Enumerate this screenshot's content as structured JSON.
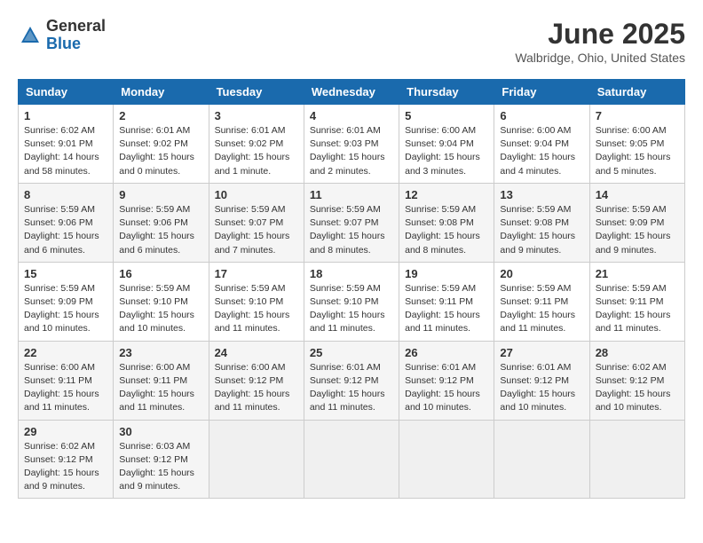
{
  "header": {
    "logo": {
      "general": "General",
      "blue": "Blue"
    },
    "title": "June 2025",
    "location": "Walbridge, Ohio, United States"
  },
  "weekdays": [
    "Sunday",
    "Monday",
    "Tuesday",
    "Wednesday",
    "Thursday",
    "Friday",
    "Saturday"
  ],
  "weeks": [
    [
      {
        "day": 1,
        "sunrise": "6:02 AM",
        "sunset": "9:01 PM",
        "daylight": "14 hours and 58 minutes."
      },
      {
        "day": 2,
        "sunrise": "6:01 AM",
        "sunset": "9:02 PM",
        "daylight": "15 hours and 0 minutes."
      },
      {
        "day": 3,
        "sunrise": "6:01 AM",
        "sunset": "9:02 PM",
        "daylight": "15 hours and 1 minute."
      },
      {
        "day": 4,
        "sunrise": "6:01 AM",
        "sunset": "9:03 PM",
        "daylight": "15 hours and 2 minutes."
      },
      {
        "day": 5,
        "sunrise": "6:00 AM",
        "sunset": "9:04 PM",
        "daylight": "15 hours and 3 minutes."
      },
      {
        "day": 6,
        "sunrise": "6:00 AM",
        "sunset": "9:04 PM",
        "daylight": "15 hours and 4 minutes."
      },
      {
        "day": 7,
        "sunrise": "6:00 AM",
        "sunset": "9:05 PM",
        "daylight": "15 hours and 5 minutes."
      }
    ],
    [
      {
        "day": 8,
        "sunrise": "5:59 AM",
        "sunset": "9:06 PM",
        "daylight": "15 hours and 6 minutes."
      },
      {
        "day": 9,
        "sunrise": "5:59 AM",
        "sunset": "9:06 PM",
        "daylight": "15 hours and 6 minutes."
      },
      {
        "day": 10,
        "sunrise": "5:59 AM",
        "sunset": "9:07 PM",
        "daylight": "15 hours and 7 minutes."
      },
      {
        "day": 11,
        "sunrise": "5:59 AM",
        "sunset": "9:07 PM",
        "daylight": "15 hours and 8 minutes."
      },
      {
        "day": 12,
        "sunrise": "5:59 AM",
        "sunset": "9:08 PM",
        "daylight": "15 hours and 8 minutes."
      },
      {
        "day": 13,
        "sunrise": "5:59 AM",
        "sunset": "9:08 PM",
        "daylight": "15 hours and 9 minutes."
      },
      {
        "day": 14,
        "sunrise": "5:59 AM",
        "sunset": "9:09 PM",
        "daylight": "15 hours and 9 minutes."
      }
    ],
    [
      {
        "day": 15,
        "sunrise": "5:59 AM",
        "sunset": "9:09 PM",
        "daylight": "15 hours and 10 minutes."
      },
      {
        "day": 16,
        "sunrise": "5:59 AM",
        "sunset": "9:10 PM",
        "daylight": "15 hours and 10 minutes."
      },
      {
        "day": 17,
        "sunrise": "5:59 AM",
        "sunset": "9:10 PM",
        "daylight": "15 hours and 11 minutes."
      },
      {
        "day": 18,
        "sunrise": "5:59 AM",
        "sunset": "9:10 PM",
        "daylight": "15 hours and 11 minutes."
      },
      {
        "day": 19,
        "sunrise": "5:59 AM",
        "sunset": "9:11 PM",
        "daylight": "15 hours and 11 minutes."
      },
      {
        "day": 20,
        "sunrise": "5:59 AM",
        "sunset": "9:11 PM",
        "daylight": "15 hours and 11 minutes."
      },
      {
        "day": 21,
        "sunrise": "5:59 AM",
        "sunset": "9:11 PM",
        "daylight": "15 hours and 11 minutes."
      }
    ],
    [
      {
        "day": 22,
        "sunrise": "6:00 AM",
        "sunset": "9:11 PM",
        "daylight": "15 hours and 11 minutes."
      },
      {
        "day": 23,
        "sunrise": "6:00 AM",
        "sunset": "9:11 PM",
        "daylight": "15 hours and 11 minutes."
      },
      {
        "day": 24,
        "sunrise": "6:00 AM",
        "sunset": "9:12 PM",
        "daylight": "15 hours and 11 minutes."
      },
      {
        "day": 25,
        "sunrise": "6:01 AM",
        "sunset": "9:12 PM",
        "daylight": "15 hours and 11 minutes."
      },
      {
        "day": 26,
        "sunrise": "6:01 AM",
        "sunset": "9:12 PM",
        "daylight": "15 hours and 10 minutes."
      },
      {
        "day": 27,
        "sunrise": "6:01 AM",
        "sunset": "9:12 PM",
        "daylight": "15 hours and 10 minutes."
      },
      {
        "day": 28,
        "sunrise": "6:02 AM",
        "sunset": "9:12 PM",
        "daylight": "15 hours and 10 minutes."
      }
    ],
    [
      {
        "day": 29,
        "sunrise": "6:02 AM",
        "sunset": "9:12 PM",
        "daylight": "15 hours and 9 minutes."
      },
      {
        "day": 30,
        "sunrise": "6:03 AM",
        "sunset": "9:12 PM",
        "daylight": "15 hours and 9 minutes."
      },
      null,
      null,
      null,
      null,
      null
    ]
  ]
}
